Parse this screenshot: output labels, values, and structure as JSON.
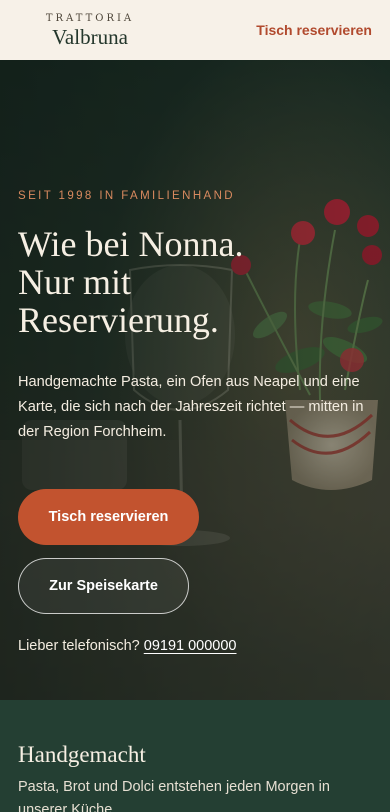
{
  "header": {
    "brand_top": "TRATTORIA",
    "brand_name": "Valbruna",
    "cta_label": "Tisch reservieren"
  },
  "hero": {
    "eyebrow": "SEIT 1998 IN FAMILIENHAND",
    "headline_line1": "Wie bei Nonna.",
    "headline_line2": "Nur mit",
    "headline_line3": "Reservierung.",
    "lead": "Handgemachte Pasta, ein Ofen aus Neapel und eine Karte, die sich nach der Jahreszeit richtet — mitten in der Region Forchheim.",
    "primary_button": "Tisch reservieren",
    "secondary_button": "Zur Speisekarte",
    "phone_prefix": "Lieber telefonisch?",
    "phone_number": "09191 000000"
  },
  "feature": {
    "title": "Handgemacht",
    "text": "Pasta, Brot und Dolci entstehen jeden Morgen in unserer Küche."
  },
  "colors": {
    "header_bg": "#f7f1e8",
    "accent": "#c2532f",
    "dark_green": "#243f33",
    "cream": "#f6efe3"
  }
}
